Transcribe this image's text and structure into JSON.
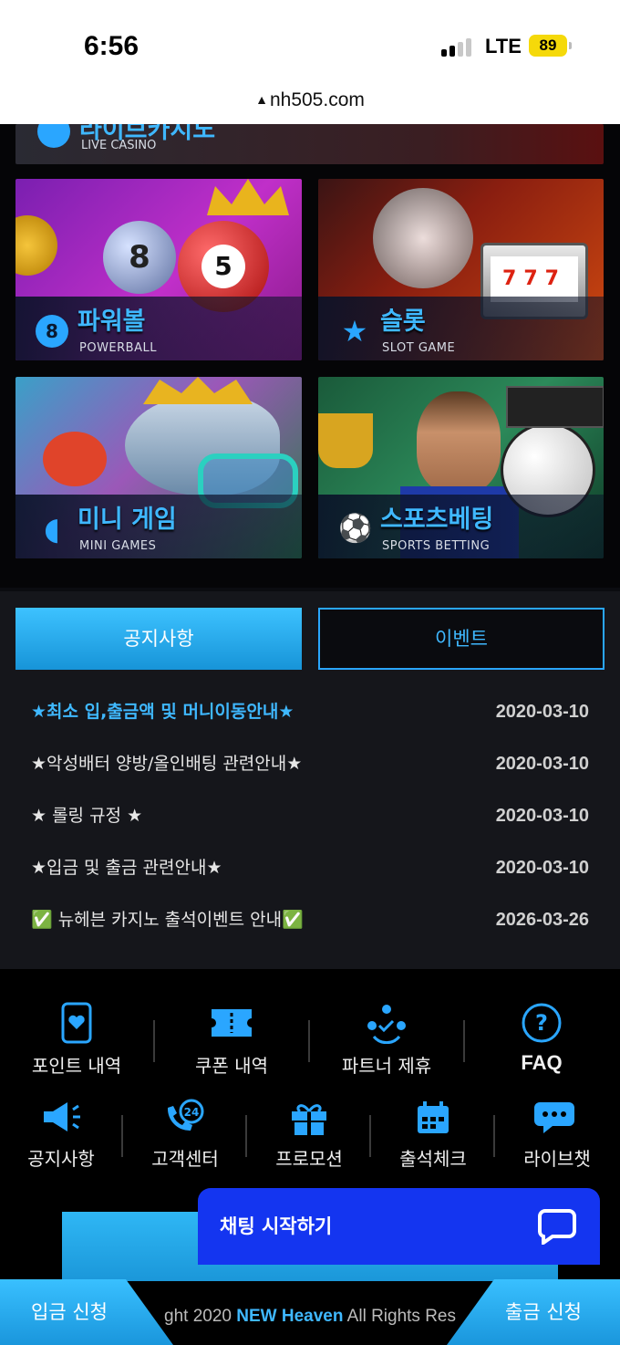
{
  "status_bar": {
    "time": "6:56",
    "network": "LTE",
    "battery": "89"
  },
  "browser": {
    "url": "nh505.com"
  },
  "games": [
    {
      "ko": "라이브카지노",
      "en": "LIVE CASINO",
      "icon": "poker-chip-icon"
    },
    {
      "ko": "파워볼",
      "en": "POWERBALL",
      "icon": "eight-ball-icon",
      "icon_glyph": "8"
    },
    {
      "ko": "슬롯",
      "en": "SLOT GAME",
      "icon": "star-icon",
      "icon_glyph": "★"
    },
    {
      "ko": "미니 게임",
      "en": "MINI GAMES",
      "icon": "pacman-icon",
      "icon_glyph": "◖"
    },
    {
      "ko": "스포츠베팅",
      "en": "SPORTS BETTING",
      "icon": "soccer-ball-icon",
      "icon_glyph": "⚽"
    }
  ],
  "tabs": [
    {
      "label": "공지사항",
      "active": true
    },
    {
      "label": "이벤트",
      "active": false
    }
  ],
  "notices": [
    {
      "title": "★최소 입,출금액 및 머니이동안내★",
      "date": "2020-03-10",
      "highlight": true
    },
    {
      "title": "★악성배터 양방/올인배팅 관련안내★",
      "date": "2020-03-10",
      "highlight": false
    },
    {
      "title": "★ 롤링 규정 ★",
      "date": "2020-03-10",
      "highlight": false
    },
    {
      "title": "★입금 및 출금 관련안내★",
      "date": "2020-03-10",
      "highlight": false
    },
    {
      "title": "✅ 뉴헤븐 카지노 출석이벤트 안내✅",
      "date": "2026-03-26",
      "highlight": false
    }
  ],
  "quick_menu_row1": [
    {
      "label": "포인트 내역",
      "icon": "phone-heart-icon"
    },
    {
      "label": "쿠폰 내역",
      "icon": "ticket-icon"
    },
    {
      "label": "파트너 제휴",
      "icon": "partner-network-icon"
    },
    {
      "label": "FAQ",
      "icon": "question-icon"
    }
  ],
  "quick_menu_row2": [
    {
      "label": "공지사항",
      "icon": "megaphone-icon"
    },
    {
      "label": "고객센터",
      "icon": "phone-24-icon"
    },
    {
      "label": "프로모션",
      "icon": "gift-icon"
    },
    {
      "label": "출석체크",
      "icon": "calendar-icon"
    },
    {
      "label": "라이브챗",
      "icon": "chat-bubbles-icon"
    }
  ],
  "chat": {
    "label": "채팅 시작하기"
  },
  "footer": {
    "prefix": "ght 2020 ",
    "brand": "NEW Heaven",
    "suffix": " All Rights Res"
  },
  "actions": {
    "deposit": "입금 신청",
    "withdraw": "출금 신청"
  },
  "colors": {
    "accent": "#2aa6ff",
    "chat": "#1435f0",
    "background": "#15161b"
  }
}
